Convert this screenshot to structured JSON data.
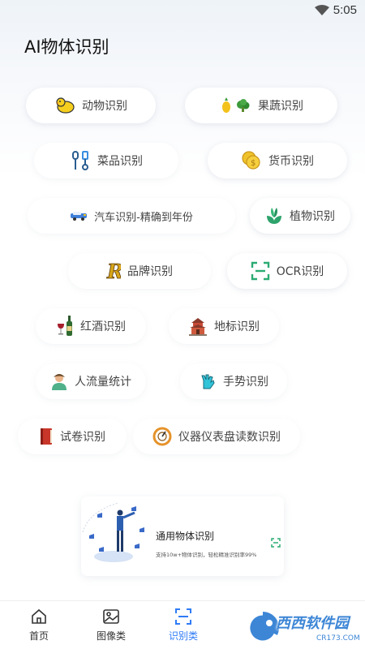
{
  "status_bar": {
    "time": "5:05",
    "icons": [
      "wifi-icon"
    ]
  },
  "page_title": "AI物体识别",
  "categories": [
    {
      "label": "动物识别",
      "icon": "chick-icon"
    },
    {
      "label": "果蔬识别",
      "icon": "fruit-vegetable-icon"
    },
    {
      "label": "菜品识别",
      "icon": "utensils-icon"
    },
    {
      "label": "货币识别",
      "icon": "coins-icon"
    },
    {
      "label": "汽车识别-精确到年份",
      "icon": "car-icon"
    },
    {
      "label": "植物识别",
      "icon": "plant-icon"
    },
    {
      "label": "品牌识别",
      "icon": "brand-icon"
    },
    {
      "label": "OCR识别",
      "icon": "scan-frame-icon"
    },
    {
      "label": "红酒识别",
      "icon": "wine-icon"
    },
    {
      "label": "地标识别",
      "icon": "landmark-icon"
    },
    {
      "label": "人流量统计",
      "icon": "person-icon"
    },
    {
      "label": "手势识别",
      "icon": "hand-gesture-icon"
    },
    {
      "label": "试卷识别",
      "icon": "book-icon"
    },
    {
      "label": "仪器仪表盘读数识别",
      "icon": "gauge-icon"
    }
  ],
  "banner": {
    "title": "通用物体识别",
    "subtitle": "支持10w+物体识别，轻松精准识别率99%"
  },
  "bottom_nav": [
    {
      "label": "首页",
      "icon": "home-icon",
      "active": false
    },
    {
      "label": "图像类",
      "icon": "image-icon",
      "active": false
    },
    {
      "label": "识别类",
      "icon": "scan-icon",
      "active": true
    }
  ],
  "watermark": "西西软件园",
  "watermark_sub": "CR173.COM",
  "colors": {
    "accent": "#2f7cf6",
    "text": "#444444",
    "title": "#111111"
  }
}
